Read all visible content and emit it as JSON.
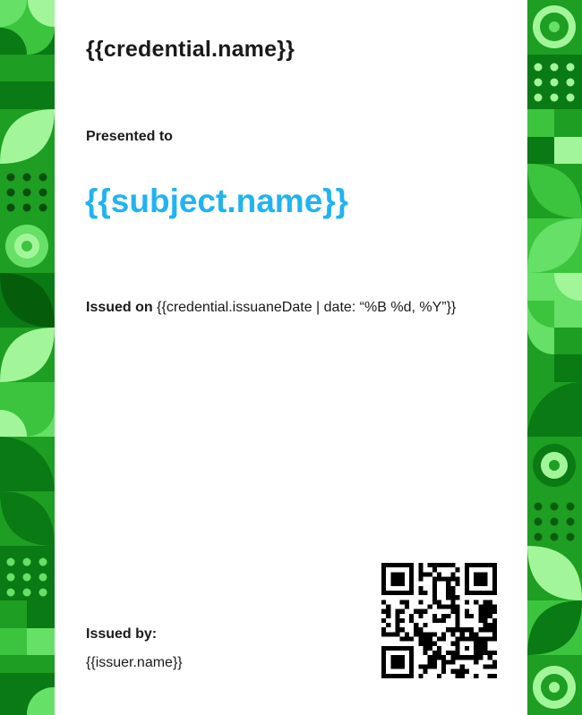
{
  "certificate": {
    "title": "{{credential.name}}",
    "presented_to_label": "Presented to",
    "subject_name": "{{subject.name}}",
    "issued_on_label": "Issued on",
    "issued_on_value": "{{credential.issuaneDate | date: “%B %d, %Y”}}",
    "issued_by_label": "Issued by:",
    "issuer_name": "{{issuer.name}}"
  },
  "colors": {
    "accent_text": "#21b3f2",
    "dark_green": "#0a7a14",
    "mid_green": "#1e9e22",
    "bright_green": "#3dc43f",
    "light_green": "#66e066",
    "pale_green": "#a3f59a"
  },
  "icons": {
    "qr": "qr-code-icon",
    "border": "geometric-green-border"
  }
}
